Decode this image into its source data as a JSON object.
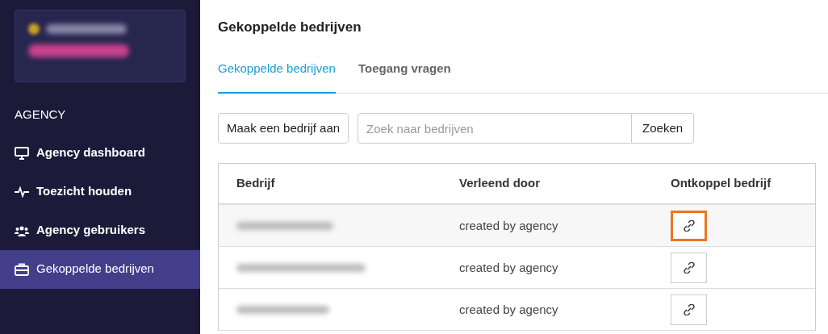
{
  "sidebar": {
    "section_title": "AGENCY",
    "items": [
      {
        "label": "Agency dashboard",
        "selected": false
      },
      {
        "label": "Toezicht houden",
        "selected": false
      },
      {
        "label": "Agency gebruikers",
        "selected": false
      },
      {
        "label": "Gekoppelde bedrijven",
        "selected": true
      }
    ]
  },
  "page_title": "Gekoppelde bedrijven",
  "tabs": [
    {
      "label": "Gekoppelde bedrijven",
      "selected": true
    },
    {
      "label": "Toegang vragen",
      "selected": false
    }
  ],
  "toolbar": {
    "create_button": "Maak een bedrijf aan",
    "search": {
      "placeholder": "Zoek naar bedrijven"
    },
    "search_button": "Zoeken"
  },
  "table": {
    "columns": [
      "Bedrijf",
      "Verleend door",
      "Ontkoppel bedrijf"
    ],
    "rows": [
      {
        "granted_by": "created by agency",
        "highlighted": true
      },
      {
        "granted_by": "created by agency",
        "highlighted": false
      },
      {
        "granted_by": "created by agency",
        "highlighted": false
      }
    ]
  }
}
